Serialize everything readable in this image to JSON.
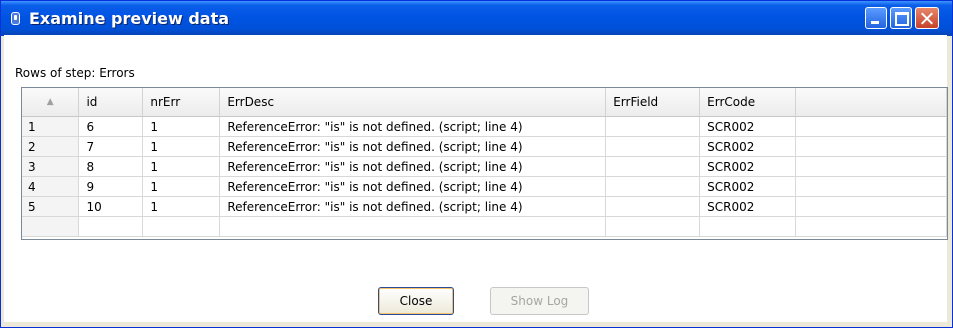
{
  "window": {
    "title": "Examine preview data"
  },
  "caption": "Rows of step: Errors",
  "table": {
    "sort_indicator": "▲",
    "columns": [
      "id",
      "nrErr",
      "ErrDesc",
      "ErrField",
      "ErrCode"
    ],
    "rows": [
      {
        "n": "1",
        "id": "6",
        "nrErr": "1",
        "ErrDesc": "ReferenceError: \"is\" is not defined. (script; line 4)",
        "ErrField": "",
        "ErrCode": "SCR002"
      },
      {
        "n": "2",
        "id": "7",
        "nrErr": "1",
        "ErrDesc": "ReferenceError: \"is\" is not defined. (script; line 4)",
        "ErrField": "",
        "ErrCode": "SCR002"
      },
      {
        "n": "3",
        "id": "8",
        "nrErr": "1",
        "ErrDesc": "ReferenceError: \"is\" is not defined. (script; line 4)",
        "ErrField": "",
        "ErrCode": "SCR002"
      },
      {
        "n": "4",
        "id": "9",
        "nrErr": "1",
        "ErrDesc": "ReferenceError: \"is\" is not defined. (script; line 4)",
        "ErrField": "",
        "ErrCode": "SCR002"
      },
      {
        "n": "5",
        "id": "10",
        "nrErr": "1",
        "ErrDesc": "ReferenceError: \"is\" is not defined. (script; line 4)",
        "ErrField": "",
        "ErrCode": "SCR002"
      }
    ]
  },
  "buttons": {
    "close": "Close",
    "show_log": "Show Log"
  },
  "icons": {
    "app": "app-icon",
    "minimize": "minimize-icon",
    "maximize": "maximize-icon",
    "close": "close-icon"
  },
  "colors": {
    "titlebar": "#0054e3",
    "window_bg": "#ece9d8"
  }
}
